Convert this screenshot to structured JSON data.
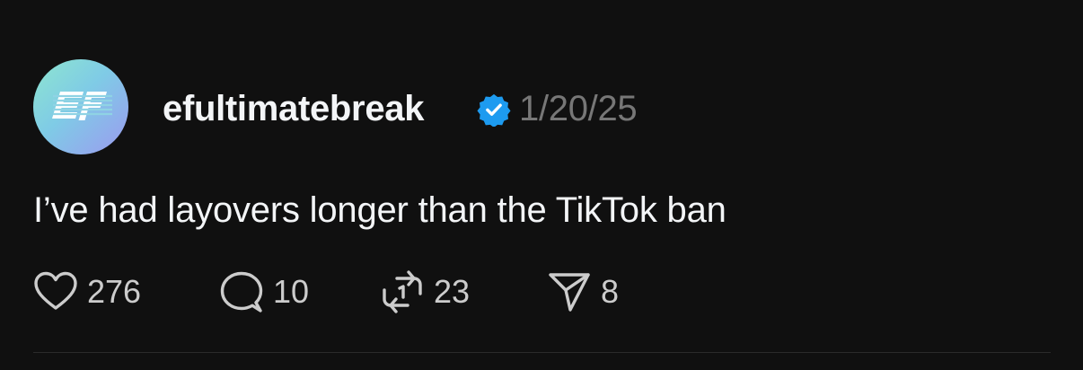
{
  "post": {
    "author": {
      "username": "efultimatebreak",
      "avatar_icon": "ef-logo-icon",
      "verified_icon": "verified-badge-icon",
      "verified_color": "#1d9bf0"
    },
    "timestamp": "1/20/25",
    "text": "I’ve had layovers longer than the TikTok ban",
    "actions": {
      "like": {
        "icon": "heart-icon",
        "count": "276"
      },
      "reply": {
        "icon": "comment-icon",
        "count": "10"
      },
      "repost": {
        "icon": "repost-icon",
        "count": "23"
      },
      "share": {
        "icon": "send-icon",
        "count": "8"
      }
    }
  },
  "colors": {
    "background": "#101010",
    "primary_text": "#f3f5f7",
    "secondary_text": "#777777",
    "icon": "#cccccc"
  }
}
